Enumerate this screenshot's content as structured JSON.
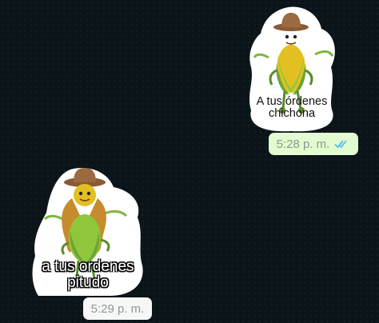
{
  "chat": {
    "background_color": "#0b1418",
    "messages": [
      {
        "direction": "outgoing",
        "kind": "sticker",
        "sticker": "corn-cowboy-sticker",
        "caption_lines": [
          "A tus órdenes",
          "chichona"
        ],
        "time": "5:28 p. m.",
        "status": "read",
        "status_icon": "double-check-icon",
        "bubble_color": "#e2fbd0",
        "status_color": "#53bdeb"
      },
      {
        "direction": "incoming",
        "kind": "sticker",
        "sticker": "corn-cowgirl-sticker",
        "caption_lines": [
          "a tus ordenes",
          "pitudo"
        ],
        "time": "5:29 p. m.",
        "bubble_color": "#f7f7f7"
      }
    ]
  }
}
